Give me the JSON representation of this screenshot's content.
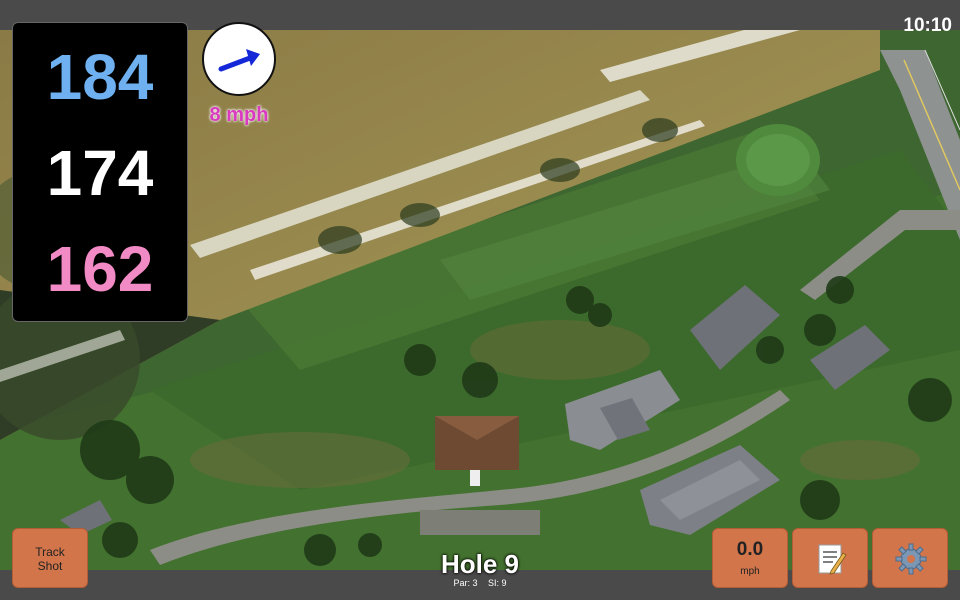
{
  "status": {
    "time": "10:10"
  },
  "yardage": {
    "back": "184",
    "center": "174",
    "front": "162"
  },
  "wind": {
    "speed_label": "8 mph",
    "icon": "wind-arrow-icon"
  },
  "buttons": {
    "track_shot": {
      "line1": "Track",
      "line2": "Shot"
    },
    "speed": {
      "value": "0.0",
      "unit": "mph"
    },
    "notes": {
      "icon": "notepad-icon"
    },
    "settings": {
      "icon": "gear-icon"
    }
  },
  "hole": {
    "title": "Hole 9",
    "par": "Par: 3",
    "si": "SI: 9"
  },
  "colors": {
    "back": "#6fb1f0",
    "center": "#ffffff",
    "front": "#f28bc5",
    "wind": "#d93ac0",
    "button": "#d2754a"
  }
}
